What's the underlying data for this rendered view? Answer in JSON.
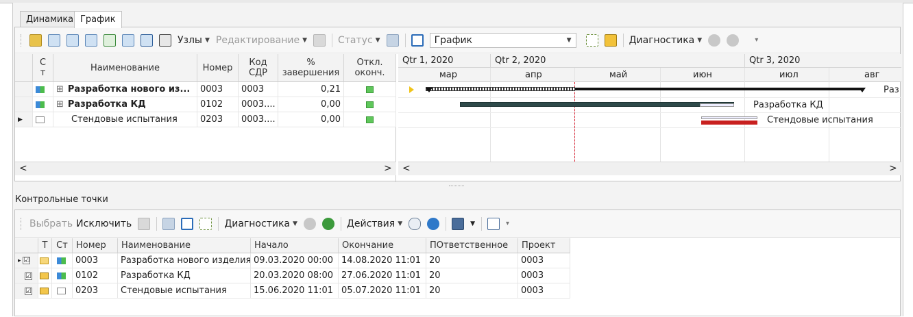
{
  "tabs": [
    "Динамика",
    "График"
  ],
  "toolbar1": {
    "nodes_label": "Узлы",
    "edit_label": "Редактирование",
    "status_label": "Статус",
    "view_value": "График",
    "diag_label": "Диагностика"
  },
  "grid": {
    "headers": {
      "st": "С т",
      "name": "Наименование",
      "number": "Номер",
      "wbs": "Код СДР",
      "percent": "% завершения",
      "dev": "Откл. оконч."
    },
    "rows": [
      {
        "name": "Разработка нового из...",
        "number": "0003",
        "wbs": "0003",
        "percent": "0,21",
        "expand": "⊞"
      },
      {
        "name": "Разработка КД",
        "number": "0102",
        "wbs": "0003....",
        "percent": "0,00",
        "expand": "⊞"
      },
      {
        "name": "Стендовые испытания",
        "number": "0203",
        "wbs": "0003....",
        "percent": "0,00",
        "expand": ""
      }
    ]
  },
  "gantt": {
    "quarters": [
      "Qtr 1, 2020",
      "Qtr 2, 2020",
      "Qtr 3, 2020"
    ],
    "months": [
      "мар",
      "апр",
      "май",
      "июн",
      "июл",
      "авг"
    ],
    "labels": [
      "Раз",
      "Разработка КД",
      "Стендовые испытания"
    ]
  },
  "control_points": {
    "title": "Контрольные точки",
    "toolbar": {
      "select": "Выбрать",
      "exclude": "Исключить",
      "diag": "Диагностика",
      "actions": "Действия"
    },
    "headers": [
      "Т",
      "Ст",
      "Номер",
      "Наименование",
      "Начало",
      "Окончание",
      "ПОтветственное",
      "Проект"
    ],
    "rows": [
      {
        "check": "☑",
        "number": "0003",
        "name": "Разработка нового изделия",
        "start": "09.03.2020 00:00",
        "end": "14.08.2020 11:01",
        "resp": "20",
        "project": "0003"
      },
      {
        "check": "☑",
        "number": "0102",
        "name": "Разработка КД",
        "start": "20.03.2020 08:00",
        "end": "27.06.2020 11:01",
        "resp": "20",
        "project": "0003"
      },
      {
        "check": "☑",
        "number": "0203",
        "name": "Стендовые испытания",
        "start": "15.06.2020 11:01",
        "end": "05.07.2020 11:01",
        "resp": "20",
        "project": "0003"
      }
    ]
  }
}
